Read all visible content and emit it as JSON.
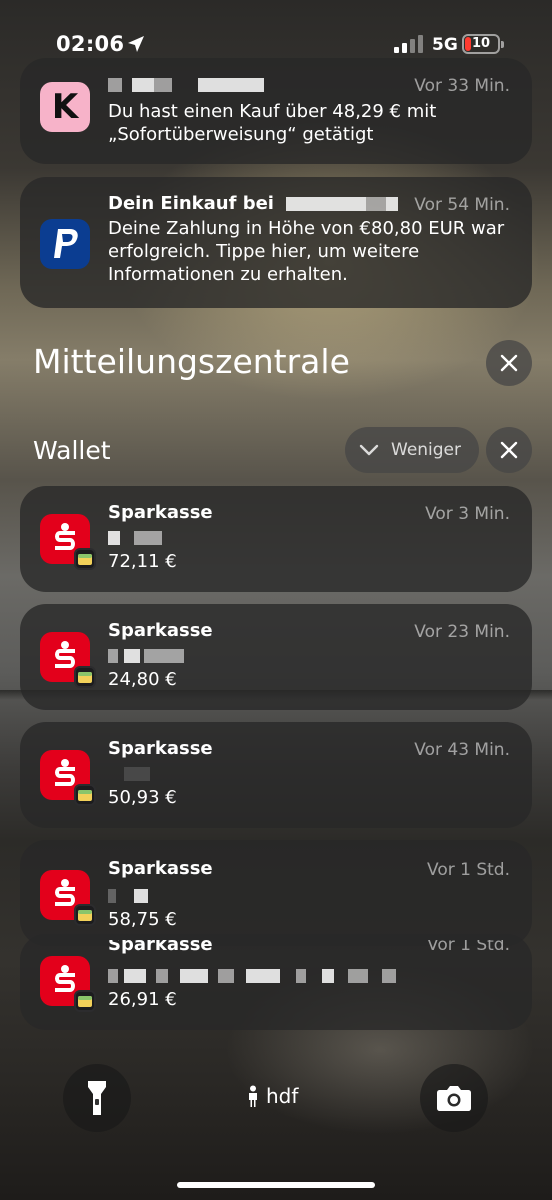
{
  "status_bar": {
    "time": "02:06",
    "network": "5G",
    "battery": "10"
  },
  "notifications": [
    {
      "app": "klarna",
      "icon_glyph": "K",
      "time_ago": "Vor 33 Min.",
      "body": "Du hast einen Kauf über 48,29 € mit „Sofortüberweisung“ getätigt"
    },
    {
      "app": "paypal",
      "title": "Dein Einkauf bei",
      "time_ago": "Vor 54 Min.",
      "body": "Deine Zahlung in Höhe von €80,80 EUR war erfolgreich. Tippe hier, um weitere Informationen zu erhalten."
    }
  ],
  "notification_center": {
    "title": "Mitteilungszentrale"
  },
  "wallet": {
    "title": "Wallet",
    "less_label": "Weniger",
    "items": [
      {
        "title": "Sparkasse",
        "time_ago": "Vor 3 Min.",
        "amount": "72,11 €"
      },
      {
        "title": "Sparkasse",
        "time_ago": "Vor 23 Min.",
        "amount": "24,80 €"
      },
      {
        "title": "Sparkasse",
        "time_ago": "Vor 43 Min.",
        "amount": "50,93 €"
      },
      {
        "title": "Sparkasse",
        "time_ago": "Vor 1 Std.",
        "amount": "58,75 €"
      },
      {
        "title": "Sparkasse",
        "time_ago": "Vor 1 Std.",
        "amount": "26,91 €"
      }
    ]
  },
  "lock_screen": {
    "owner": "hdf",
    "flashlight_icon": "flashlight-icon",
    "camera_icon": "camera-icon"
  }
}
